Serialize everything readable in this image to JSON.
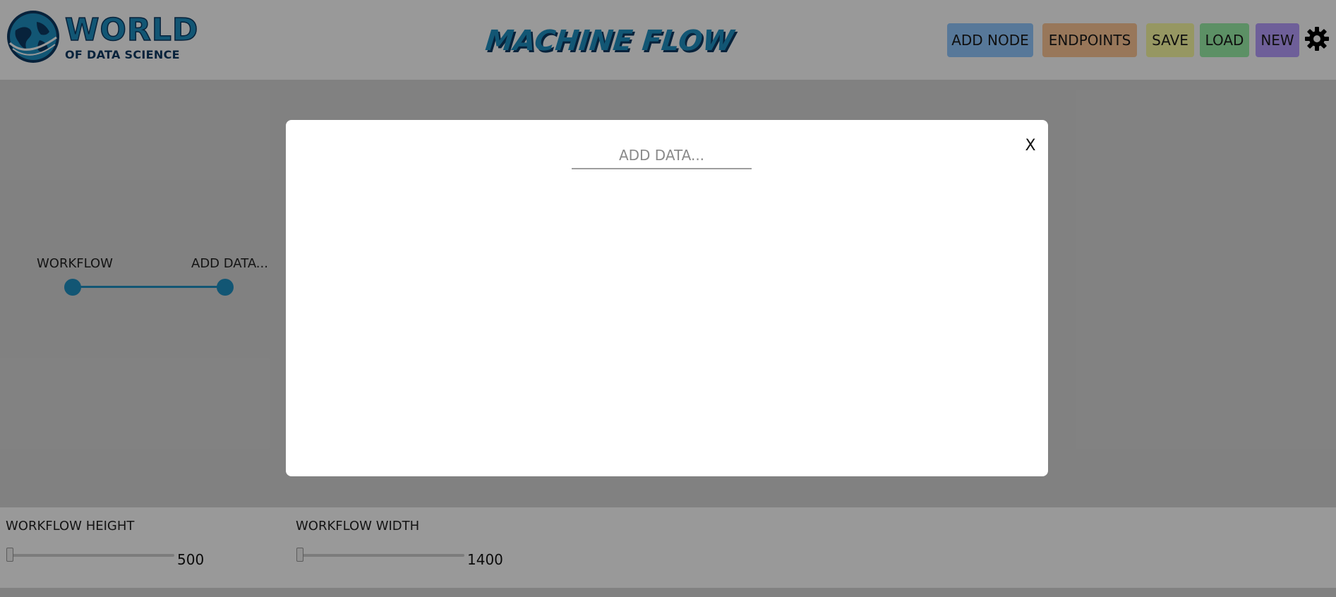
{
  "header": {
    "logo": {
      "word": "WORLD",
      "subtitle": "OF DATA SCIENCE",
      "icon": "globe-icon"
    },
    "app_title": "MACHINE FLOW",
    "buttons": {
      "add_node": "ADD NODE",
      "endpoints": "ENDPOINTS",
      "save": "SAVE",
      "load": "LOAD",
      "new": "NEW"
    },
    "settings_icon": "gear-icon"
  },
  "workflow": {
    "nodes": [
      {
        "label": "WORKFLOW"
      },
      {
        "label": "ADD DATA..."
      }
    ]
  },
  "controls": {
    "height": {
      "label": "WORKFLOW HEIGHT",
      "value": "500"
    },
    "width": {
      "label": "WORKFLOW WIDTH",
      "value": "1400"
    }
  },
  "modal": {
    "input_placeholder": "ADD DATA...",
    "close_label": "X"
  },
  "colors": {
    "brand_blue": "#1f8fc1",
    "brand_navy": "#0d3a63",
    "add_node_bg": "#92c8ff",
    "endpoints_bg": "#fec796",
    "save_bg": "#fbfca3",
    "load_bg": "#9af0a8",
    "new_bg": "#b89eff"
  }
}
